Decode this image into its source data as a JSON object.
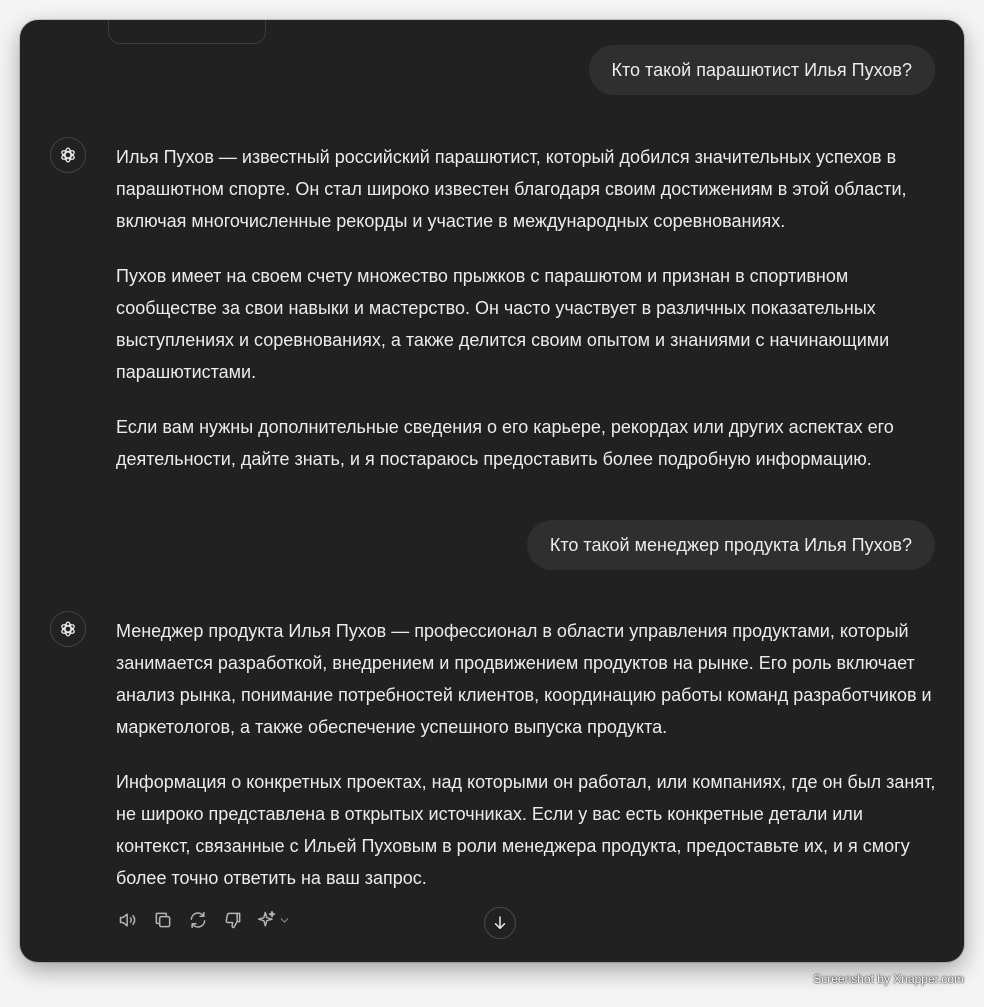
{
  "colors": {
    "window_bg": "#212121",
    "user_bubble_bg": "#2f2f2f",
    "text": "#ececec",
    "icon": "#b4b4b4"
  },
  "messages": [
    {
      "role": "user",
      "text": "Кто такой парашютист Илья Пухов?"
    },
    {
      "role": "assistant",
      "avatar_icon": "chatgpt-logo-icon",
      "paragraphs": [
        "Илья Пухов — известный российский парашютист, который добился значительных успехов в парашютном спорте. Он стал широко известен благодаря своим достижениям в этой области, включая многочисленные рекорды и участие в международных соревнованиях.",
        "Пухов имеет на своем счету множество прыжков с парашютом и признан в спортивном сообществе за свои навыки и мастерство. Он часто участвует в различных показательных выступлениях и соревнованиях, а также делится своим опытом и знаниями с начинающими парашютистами.",
        "Если вам нужны дополнительные сведения о его карьере, рекордах или других аспектах его деятельности, дайте знать, и я постараюсь предоставить более подробную информацию."
      ]
    },
    {
      "role": "user",
      "text": "Кто такой менеджер продукта Илья Пухов?"
    },
    {
      "role": "assistant",
      "avatar_icon": "chatgpt-logo-icon",
      "paragraphs": [
        "Менеджер продукта Илья Пухов — профессионал в области управления продуктами, который занимается разработкой, внедрением и продвижением продуктов на рынке. Его роль включает анализ рынка, понимание потребностей клиентов, координацию работы команд разработчиков и маркетологов, а также обеспечение успешного выпуска продукта.",
        "Информация о конкретных проектах, над которыми он работал, или компаниях, где он был занят, не широко представлена в открытых источниках. Если у вас есть конкретные детали или контекст, связанные с Ильей Пуховым в роли менеджера продукта, предоставьте их, и я смогу более точно ответить на ваш запрос."
      ]
    }
  ],
  "message_actions": [
    "read-aloud-icon",
    "copy-icon",
    "regenerate-icon",
    "thumbs-down-icon",
    "sparkle-icon",
    "chevron-down-icon"
  ],
  "scroll_button_icon": "arrow-down-icon",
  "watermark": "Screenshot by Xnapper.com"
}
